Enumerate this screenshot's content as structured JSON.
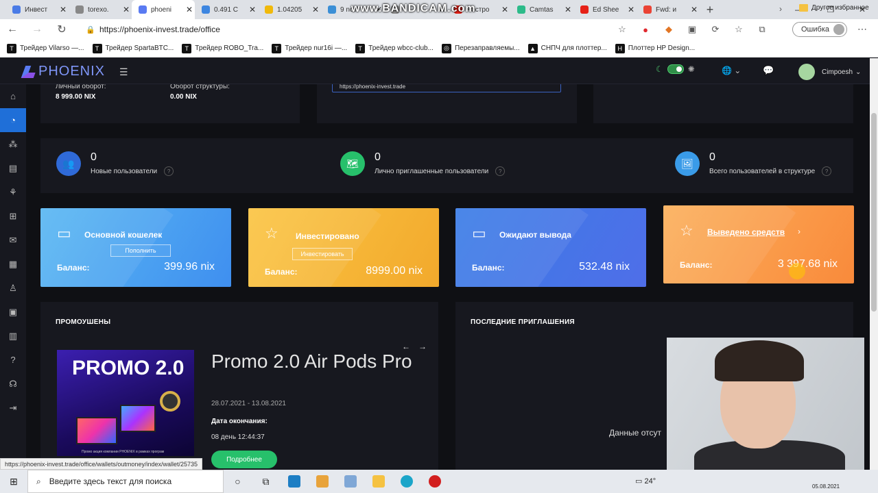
{
  "browser": {
    "tabs": [
      {
        "title": "Инвест",
        "color": "#4a7be6"
      },
      {
        "title": "torexo.",
        "color": "#888"
      },
      {
        "title": "phoeni",
        "color": "#5a7bf2",
        "active": true
      },
      {
        "title": "0.491 С",
        "color": "#3d86e0"
      },
      {
        "title": "1.04205",
        "color": "#f0b90b"
      },
      {
        "title": "9 not",
        "color": "#3b8fd6"
      },
      {
        "title": "",
        "color": "#888"
      },
      {
        "title": "Настро",
        "color": "#e62117"
      },
      {
        "title": "Camtas",
        "color": "#2dbb8a"
      },
      {
        "title": "Ed Shee",
        "color": "#e62117"
      },
      {
        "title": "Fwd: и",
        "color": "#ea4335"
      }
    ],
    "watermark": "www.BANDICAM.com",
    "url": "https://phoenix-invest.trade/office",
    "incognito": "Ошибка",
    "bookmarks": [
      "Трейдер Vilarso —...",
      "Трейдер SpartaBTC...",
      "Трейдер ROBO_Tra...",
      "Трейдер nur16i —...",
      "Трейдер wbcc-club...",
      "Перезаправляемы...",
      "СНПЧ для плоттер...",
      "Плоттер HP Design..."
    ],
    "other_bookmarks": "Другое избранное"
  },
  "app": {
    "logo": "PHOENIX",
    "user": "Cimpoesh",
    "top": {
      "personal_turnover_label": "Личный оборот:",
      "personal_turnover": "8 999.00 NIX",
      "structure_turnover_label": "Оборот структуры:",
      "structure_turnover": "0.00 NIX",
      "partner_link": "https://phoenix-invest.trade"
    },
    "stats": [
      {
        "value": "0",
        "label": "Новые пользователи",
        "color": "#2f6ad8"
      },
      {
        "value": "0",
        "label": "Лично приглашенные пользователи",
        "color": "#27c06b"
      },
      {
        "value": "0",
        "label": "Всего пользователей в структуре",
        "color": "#3a9be8"
      }
    ],
    "wallets": [
      {
        "title": "Основной кошелек",
        "button": "Пополнить",
        "balance_label": "Баланс:",
        "amount": "399.96 nix"
      },
      {
        "title": "Инвестировано",
        "button": "Инвестировать",
        "balance_label": "Баланс:",
        "amount": "8999.00 nix"
      },
      {
        "title": "Ожидают вывода",
        "button": "",
        "balance_label": "Баланс:",
        "amount": "532.48 nix"
      },
      {
        "title": "Выведено средств",
        "button": "",
        "balance_label": "Баланс:",
        "amount": "3 397.68 nix"
      }
    ],
    "promo": {
      "section": "ПРОМОУШЕНЫ",
      "image_text": "PROMO 2.0",
      "image_caption": "Промо акция компании PHOENIX в рамках програм",
      "title": "Promo 2.0 Air Pods Pro",
      "dates": "28.07.2021 - 13.08.2021",
      "end_label": "Дата окончания:",
      "end_value": "08 день 12:44:37",
      "more": "Подробнее"
    },
    "invites": {
      "section": "ПОСЛЕДНИЕ ПРИГЛАШЕНИЯ",
      "empty": "Данные отсут"
    },
    "status_url": "https://phoenix-invest.trade/office/wallets/outmoney/index/wallet/25735"
  },
  "taskbar": {
    "search": "Введите здесь текст для поиска",
    "temp": "24°",
    "date": "05.08.2021"
  }
}
